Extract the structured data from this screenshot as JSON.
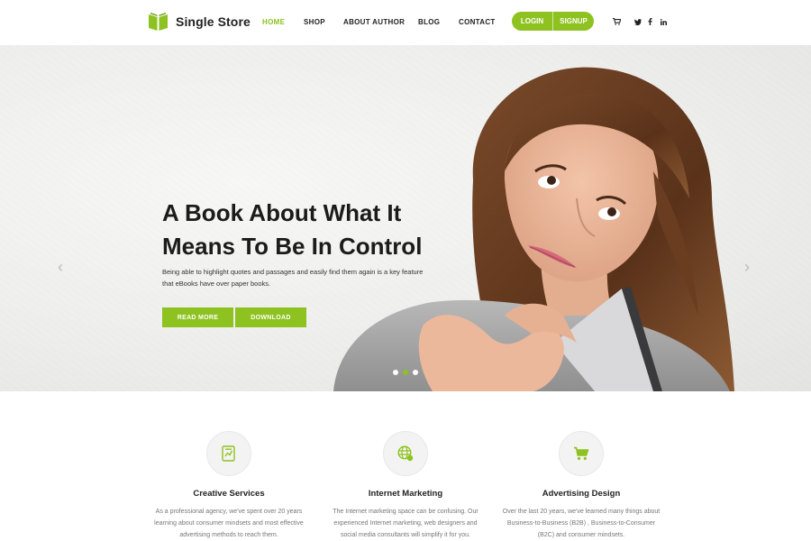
{
  "brand": {
    "name": "Single Store",
    "accent": "#8dc220"
  },
  "nav": {
    "items": [
      {
        "label": "HOME",
        "active": true
      },
      {
        "label": "SHOP",
        "active": false
      },
      {
        "label": "ABOUT AUTHOR",
        "active": false
      },
      {
        "label": "BLOG",
        "active": false
      },
      {
        "label": "CONTACT",
        "active": false
      }
    ],
    "login": "LOGIN",
    "signup": "SIGNUP",
    "icons": [
      "cart-icon",
      "twitter-icon",
      "facebook-icon",
      "linkedin-icon"
    ]
  },
  "hero": {
    "title_line1": "A Book About What It",
    "title_line2": "Means To Be In Control",
    "text": "Being able to highlight quotes and passages and easily find them again is a key feature that eBooks have over paper books.",
    "btn_read": "READ MORE",
    "btn_download": "DOWNLOAD",
    "slides": 3,
    "active_slide": 2
  },
  "services": [
    {
      "icon": "document-chart-icon",
      "title": "Creative Services",
      "text": "As a professional agency, we've spent over 20 years learning about consumer mindsets and most effective advertising methods to reach them."
    },
    {
      "icon": "globe-icon",
      "title": "Internet Marketing",
      "text": "The Internet marketing space can be confusing. Our experienced Internet marketing, web designers and social media consultants will simplify it for you."
    },
    {
      "icon": "shopping-cart-icon",
      "title": "Advertising Design",
      "text": "Over the last 20 years, we've learned many things about Business-to-Business (B2B) , Business-to-Consumer (B2C) and consumer mindsets."
    }
  ]
}
